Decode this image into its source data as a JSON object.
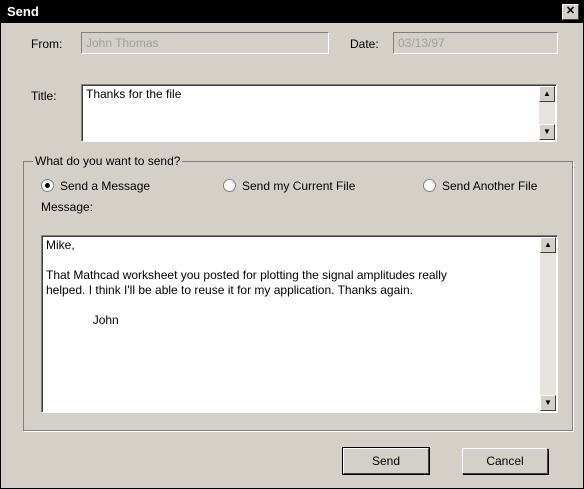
{
  "window": {
    "title": "Send"
  },
  "header": {
    "from_label": "From:",
    "from_value": "John Thomas",
    "date_label": "Date:",
    "date_value": "03/13/97",
    "title_label": "Title:",
    "title_value": "Thanks for the file"
  },
  "send_group": {
    "label": "What do you want to send?",
    "options": [
      {
        "label": "Send a Message",
        "checked": true
      },
      {
        "label": "Send my Current File",
        "checked": false
      },
      {
        "label": "Send Another File",
        "checked": false
      }
    ]
  },
  "message": {
    "label": "Message:",
    "text": "Mike,\n\nThat Mathcad worksheet you posted for plotting the signal amplitudes really\nhelped. I think I'll be able to reuse it for my application. Thanks again.\n\n              John"
  },
  "buttons": {
    "send": "Send",
    "cancel": "Cancel"
  }
}
